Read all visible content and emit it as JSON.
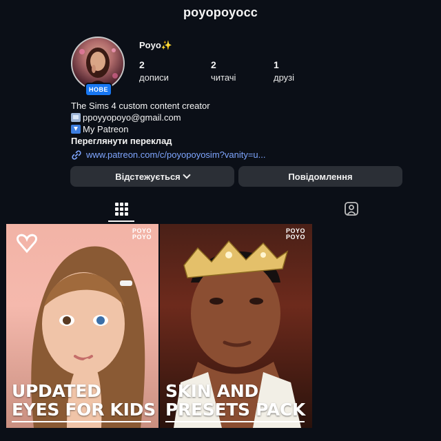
{
  "header": {
    "username": "poyopoyocc"
  },
  "profile": {
    "display_name": "Poyo✨",
    "badge": "НОВЕ",
    "stats": [
      {
        "value": "2",
        "label": "дописи"
      },
      {
        "value": "2",
        "label": "читачі"
      },
      {
        "value": "1",
        "label": "друзі"
      }
    ],
    "bio": {
      "line1": "The Sims 4 custom content creator",
      "email": "ppoyyopoyo@gmail.com",
      "patreon": "My Patreon",
      "translate": "Переглянути переклад",
      "link": "www.patreon.com/c/poyopoyosim?vanity=u..."
    },
    "icons": {
      "email": "envelope-emoji-icon",
      "patreon": "down-arrow-emoji-icon",
      "link": "link-icon"
    }
  },
  "actions": {
    "follow_label": "Відстежується",
    "message_label": "Повідомлення"
  },
  "tabs": {
    "grid": "grid-icon",
    "tagged": "tagged-icon"
  },
  "posts": [
    {
      "brand": "POYO\nPOYO",
      "title_line1": "UPDATED",
      "title_line2": "EYES FOR KIDS"
    },
    {
      "brand": "POYO\nPOYO",
      "title_line1": "SKIN AND",
      "title_line2": "PRESETS PACK"
    }
  ],
  "colors": {
    "background": "#0b0f17",
    "button": "#2b2f36",
    "link": "#7fa6ff",
    "badge": "#1877f2"
  }
}
